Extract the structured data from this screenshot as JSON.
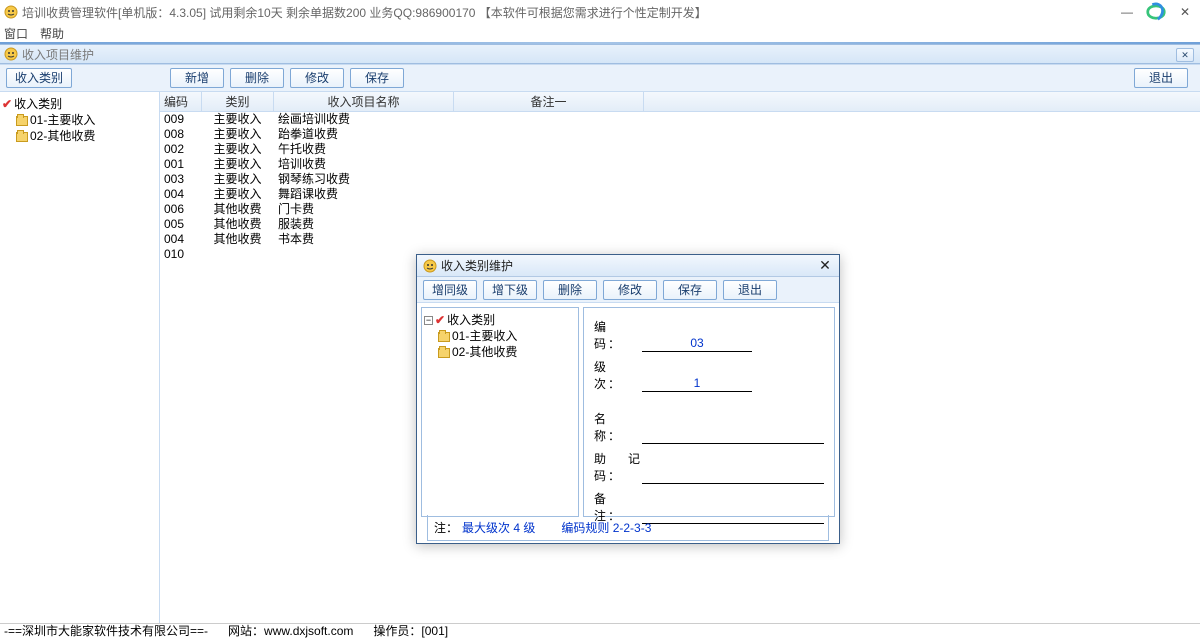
{
  "app": {
    "title": "培训收费管理软件[单机版：4.3.05]  试用剩余10天  剩余单据数200            业务QQ:986900170   【本软件可根据您需求进行个性定制开发】"
  },
  "menu": {
    "window": "窗口",
    "help": "帮助"
  },
  "subWindow": {
    "title": "收入项目维护"
  },
  "mainToolbar": {
    "category": "收入类别",
    "add": "新增",
    "delete": "删除",
    "modify": "修改",
    "save": "保存",
    "exit": "退出"
  },
  "mainTree": {
    "root": "收入类别",
    "items": [
      {
        "code": "01",
        "label": "01-主要收入"
      },
      {
        "code": "02",
        "label": "02-其他收费"
      }
    ]
  },
  "gridHeaders": {
    "code": "编码",
    "category": "类别",
    "name": "收入项目名称",
    "note": "备注一"
  },
  "gridRows": [
    {
      "code": "009",
      "category": "主要收入",
      "name": "绘画培训收费",
      "note": ""
    },
    {
      "code": "008",
      "category": "主要收入",
      "name": "跆拳道收费",
      "note": ""
    },
    {
      "code": "002",
      "category": "主要收入",
      "name": "午托收费",
      "note": ""
    },
    {
      "code": "001",
      "category": "主要收入",
      "name": "培训收费",
      "note": ""
    },
    {
      "code": "003",
      "category": "主要收入",
      "name": "钢琴练习收费",
      "note": ""
    },
    {
      "code": "004",
      "category": "主要收入",
      "name": "舞蹈课收费",
      "note": ""
    },
    {
      "code": "006",
      "category": "其他收费",
      "name": "门卡费",
      "note": ""
    },
    {
      "code": "005",
      "category": "其他收费",
      "name": "服装费",
      "note": ""
    },
    {
      "code": "004",
      "category": "其他收费",
      "name": "书本费",
      "note": ""
    },
    {
      "code": "010",
      "category": "",
      "name": "",
      "note": ""
    }
  ],
  "dialog": {
    "title": "收入类别维护",
    "toolbar": {
      "addSame": "增同级",
      "addSub": "增下级",
      "delete": "删除",
      "modify": "修改",
      "save": "保存",
      "exit": "退出"
    },
    "tree": {
      "root": "收入类别",
      "items": [
        {
          "label": "01-主要收入"
        },
        {
          "label": "02-其他收费"
        }
      ]
    },
    "form": {
      "codeLabel": "编　码：",
      "codeValue": "03",
      "levelLabel": "级　次：",
      "levelValue": "1",
      "nameLabel": "名　称：",
      "mnemonicLabel": "助记码：",
      "noteLabel": "备　注："
    },
    "footer": {
      "noteLabel": "注：",
      "maxLevel": "最大级次 4 级",
      "codeRule": "编码规则  2-2-3-3"
    }
  },
  "status": {
    "company": "-==深圳市大能家软件技术有限公司==-",
    "site": "网站：www.dxjsoft.com",
    "operator": "操作员：[001]"
  }
}
